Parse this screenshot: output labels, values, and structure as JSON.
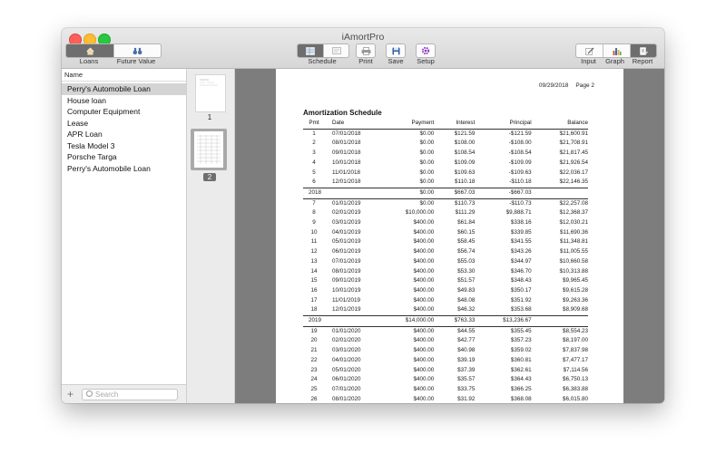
{
  "window": {
    "title": "iAmortPro"
  },
  "toolbar": {
    "left_segment": [
      {
        "label": "Loans",
        "icon": "house-icon"
      },
      {
        "label": "Future Value",
        "icon": "binoculars-icon"
      }
    ],
    "center_segment": {
      "label": "Schedule"
    },
    "print_label": "Print",
    "save_label": "Save",
    "setup_label": "Setup",
    "input_label": "Input",
    "graph_label": "Graph",
    "report_label": "Report"
  },
  "sidebar": {
    "header": "Name",
    "items": [
      "Perry's Automobile Loan",
      "House loan",
      "Computer Equipment",
      "Lease",
      "APR Loan",
      "Tesla Model 3",
      "Porsche Targa",
      "Perry's Automobile Loan"
    ],
    "selected_index": 0,
    "search_placeholder": "Search",
    "add_label": "+"
  },
  "thumbnails": {
    "page1": "1",
    "page2": "2"
  },
  "report": {
    "date": "09/29/2018",
    "page": "Page 2",
    "title": "Amortization Schedule",
    "columns": [
      "Pmt",
      "Date",
      "Payment",
      "Interest",
      "Principal",
      "Balance"
    ],
    "rows": [
      [
        "1",
        "07/01/2018",
        "$0.00",
        "$121.59",
        "-$121.59",
        "$21,600.91"
      ],
      [
        "2",
        "08/01/2018",
        "$0.00",
        "$108.00",
        "-$108.00",
        "$21,708.91"
      ],
      [
        "3",
        "09/01/2018",
        "$0.00",
        "$108.54",
        "-$108.54",
        "$21,817.45"
      ],
      [
        "4",
        "10/01/2018",
        "$0.00",
        "$109.09",
        "-$109.09",
        "$21,926.54"
      ],
      [
        "5",
        "11/01/2018",
        "$0.00",
        "$109.63",
        "-$109.63",
        "$22,036.17"
      ],
      [
        "6",
        "12/01/2018",
        "$0.00",
        "$110.18",
        "-$110.18",
        "$22,146.35"
      ],
      {
        "total": true,
        "cells": [
          "2018",
          "",
          "$0.00",
          "$667.03",
          "-$667.03",
          ""
        ]
      },
      [
        "7",
        "01/01/2019",
        "$0.00",
        "$110.73",
        "-$110.73",
        "$22,257.08"
      ],
      [
        "8",
        "02/01/2019",
        "$10,000.00",
        "$111.29",
        "$9,888.71",
        "$12,368.37"
      ],
      [
        "9",
        "03/01/2019",
        "$400.00",
        "$61.84",
        "$338.16",
        "$12,030.21"
      ],
      [
        "10",
        "04/01/2019",
        "$400.00",
        "$60.15",
        "$339.85",
        "$11,690.36"
      ],
      [
        "11",
        "05/01/2019",
        "$400.00",
        "$58.45",
        "$341.55",
        "$11,348.81"
      ],
      [
        "12",
        "06/01/2019",
        "$400.00",
        "$56.74",
        "$343.26",
        "$11,005.55"
      ],
      [
        "13",
        "07/01/2019",
        "$400.00",
        "$55.03",
        "$344.97",
        "$10,660.58"
      ],
      [
        "14",
        "08/01/2019",
        "$400.00",
        "$53.30",
        "$346.70",
        "$10,313.88"
      ],
      [
        "15",
        "09/01/2019",
        "$400.00",
        "$51.57",
        "$348.43",
        "$9,965.45"
      ],
      [
        "16",
        "10/01/2019",
        "$400.00",
        "$49.83",
        "$350.17",
        "$9,615.28"
      ],
      [
        "17",
        "11/01/2019",
        "$400.00",
        "$48.08",
        "$351.92",
        "$9,263.36"
      ],
      [
        "18",
        "12/01/2019",
        "$400.00",
        "$46.32",
        "$353.68",
        "$8,909.68"
      ],
      {
        "total": true,
        "cells": [
          "2019",
          "",
          "$14,000.00",
          "$763.33",
          "$13,236.67",
          ""
        ]
      },
      [
        "19",
        "01/01/2020",
        "$400.00",
        "$44.55",
        "$355.45",
        "$8,554.23"
      ],
      [
        "20",
        "02/01/2020",
        "$400.00",
        "$42.77",
        "$357.23",
        "$8,197.00"
      ],
      [
        "21",
        "03/01/2020",
        "$400.00",
        "$40.98",
        "$359.02",
        "$7,837.98"
      ],
      [
        "22",
        "04/01/2020",
        "$400.00",
        "$39.19",
        "$360.81",
        "$7,477.17"
      ],
      [
        "23",
        "05/01/2020",
        "$400.00",
        "$37.39",
        "$362.61",
        "$7,114.56"
      ],
      [
        "24",
        "06/01/2020",
        "$400.00",
        "$35.57",
        "$364.43",
        "$6,750.13"
      ],
      [
        "25",
        "07/01/2020",
        "$400.00",
        "$33.75",
        "$366.25",
        "$6,383.88"
      ],
      [
        "26",
        "08/01/2020",
        "$400.00",
        "$31.92",
        "$368.08",
        "$6,015.80"
      ]
    ]
  }
}
